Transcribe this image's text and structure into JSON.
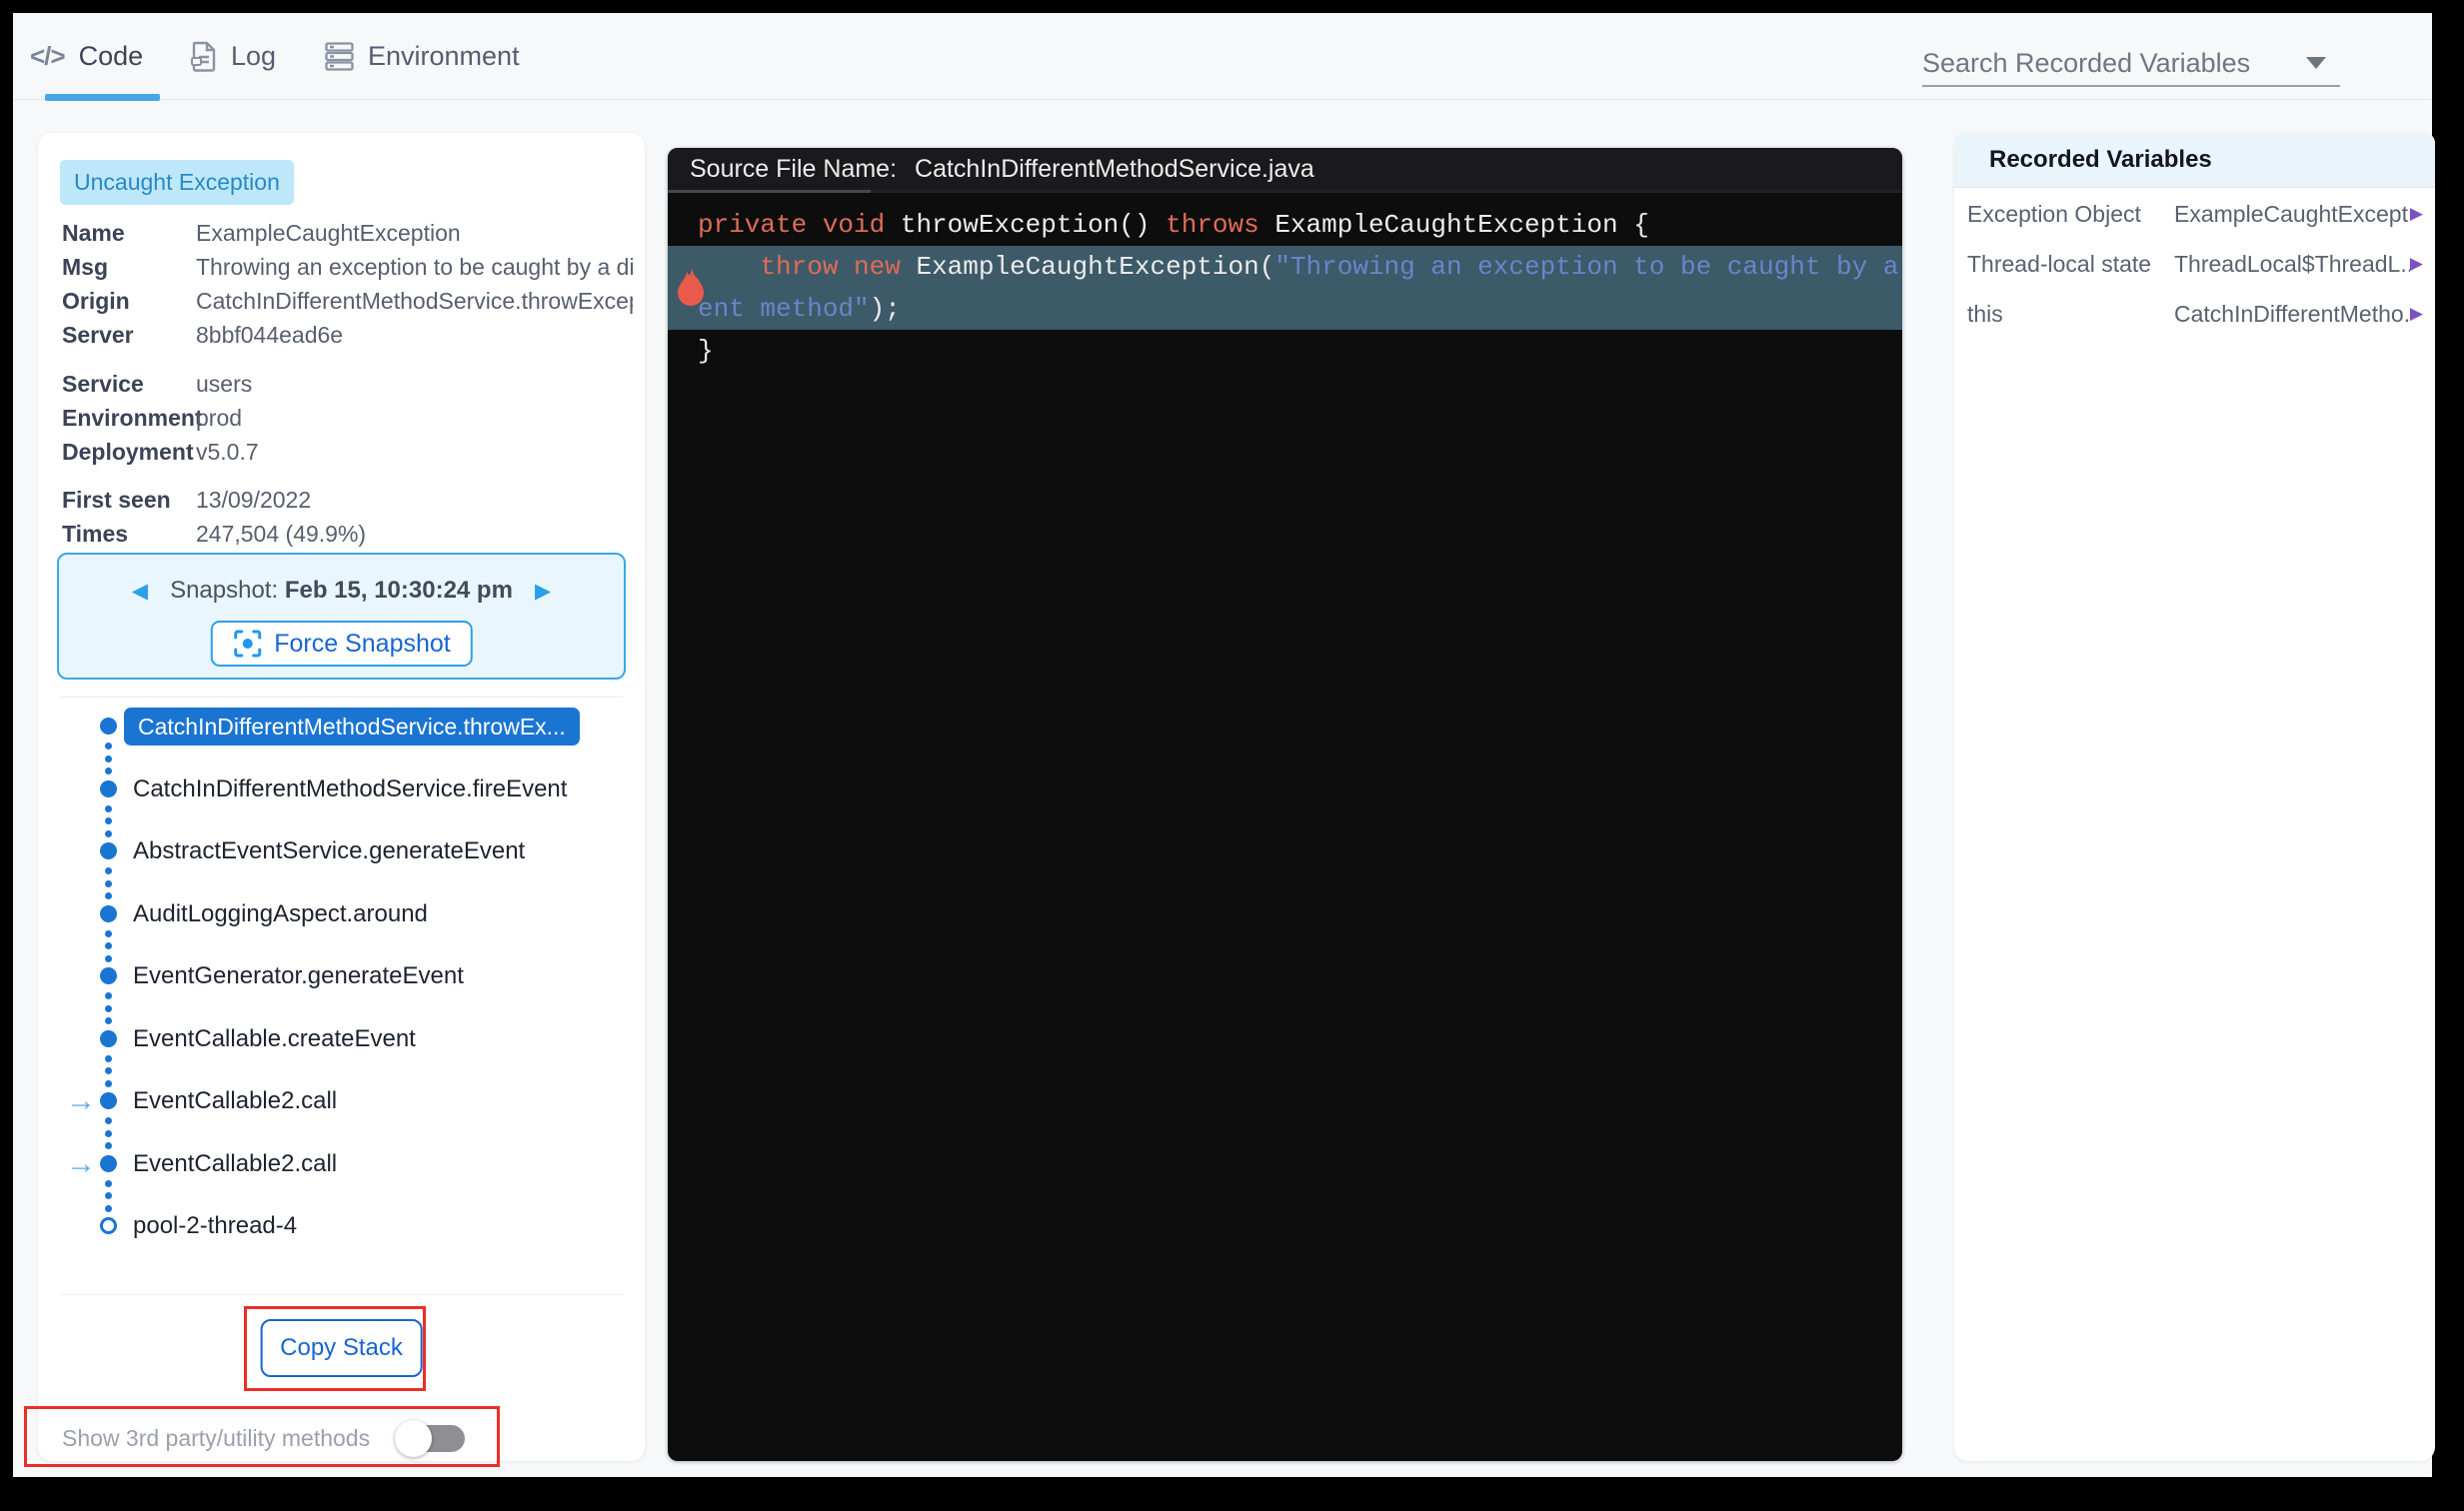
{
  "tabs": [
    {
      "label": "Code",
      "icon": "code-icon",
      "active": true
    },
    {
      "label": "Log",
      "icon": "log-icon",
      "active": false
    },
    {
      "label": "Environment",
      "icon": "environment-icon",
      "active": false
    }
  ],
  "search_select": {
    "placeholder": "Search Recorded Variables"
  },
  "exception": {
    "badge": "Uncaught Exception",
    "details": [
      {
        "label": "Name",
        "value": "ExampleCaughtException"
      },
      {
        "label": "Msg",
        "value": "Throwing an exception to be caught by a dif"
      },
      {
        "label": "Origin",
        "value": "CatchInDifferentMethodService.throwExcep"
      },
      {
        "label": "Server",
        "value": "8bbf044ead6e"
      }
    ],
    "deployment_details": [
      {
        "label": "Service",
        "value": "users"
      },
      {
        "label": "Environment",
        "value": "prod"
      },
      {
        "label": "Deployment",
        "value": "v5.0.7"
      }
    ],
    "stats": [
      {
        "label": "First seen",
        "value": "13/09/2022"
      },
      {
        "label": "Times",
        "value": "247,504 (49.9%)"
      }
    ]
  },
  "snapshot": {
    "label": "Snapshot:",
    "timestamp": "Feb 15, 10:30:24 pm",
    "prev_arrow": "◀",
    "next_arrow": "▶",
    "force_button": "Force Snapshot"
  },
  "stack": {
    "frames": [
      {
        "label": "CatchInDifferentMethodService.throwEx...",
        "selected": true,
        "arrow": false,
        "thread": false
      },
      {
        "label": "CatchInDifferentMethodService.fireEvent",
        "selected": false,
        "arrow": false,
        "thread": false
      },
      {
        "label": "AbstractEventService.generateEvent",
        "selected": false,
        "arrow": false,
        "thread": false
      },
      {
        "label": "AuditLoggingAspect.around",
        "selected": false,
        "arrow": false,
        "thread": false
      },
      {
        "label": "EventGenerator.generateEvent",
        "selected": false,
        "arrow": false,
        "thread": false
      },
      {
        "label": "EventCallable.createEvent",
        "selected": false,
        "arrow": false,
        "thread": false
      },
      {
        "label": "EventCallable2.call",
        "selected": false,
        "arrow": true,
        "thread": false
      },
      {
        "label": "EventCallable2.call",
        "selected": false,
        "arrow": true,
        "thread": false
      },
      {
        "label": "pool-2-thread-4",
        "selected": false,
        "arrow": false,
        "thread": true
      }
    ],
    "arrow_glyph": "→",
    "copy_button": "Copy Stack",
    "toggle_label": "Show 3rd party/utility methods",
    "toggle_on": false
  },
  "code_panel": {
    "header_label": "Source File Name:",
    "file_name": "CatchInDifferentMethodService.java",
    "lines": [
      {
        "highlight": false,
        "tokens": [
          {
            "c": "k",
            "t": "private"
          },
          {
            "c": "p",
            "t": " "
          },
          {
            "c": "k",
            "t": "void"
          },
          {
            "c": "p",
            "t": " throwException() "
          },
          {
            "c": "k",
            "t": "throws"
          },
          {
            "c": "p",
            "t": " ExampleCaughtException {"
          }
        ]
      },
      {
        "highlight": true,
        "tokens": [
          {
            "c": "p",
            "t": "    "
          },
          {
            "c": "k",
            "t": "throw"
          },
          {
            "c": "p",
            "t": " "
          },
          {
            "c": "k",
            "t": "new"
          },
          {
            "c": "p",
            "t": " ExampleCaughtException("
          },
          {
            "c": "s",
            "t": "\"Throwing an exception to be caught by a differ"
          }
        ]
      },
      {
        "highlight": true,
        "tokens": [
          {
            "c": "s",
            "t": "ent method\""
          },
          {
            "c": "p",
            "t": ");"
          }
        ]
      },
      {
        "highlight": false,
        "tokens": [
          {
            "c": "p",
            "t": "}"
          }
        ]
      }
    ]
  },
  "recorded_variables": {
    "title": "Recorded Variables",
    "expand_glyph": "▶",
    "rows": [
      {
        "name": "Exception Object",
        "value": "ExampleCaughtExcept..."
      },
      {
        "name": "Thread-local state",
        "value": "ThreadLocal$ThreadL..."
      },
      {
        "name": "this",
        "value": "CatchInDifferentMetho..."
      }
    ]
  },
  "colors": {
    "accent_blue": "#1a75d2",
    "light_blue_border": "#3aa9e9",
    "badge_bg": "#bee8fa",
    "highlight_row": "#3d5a68",
    "keyword": "#e06c55",
    "string": "#6d83cc",
    "annotation_red": "#ea2f27",
    "variable_arrow_purple": "#7b52c1"
  }
}
